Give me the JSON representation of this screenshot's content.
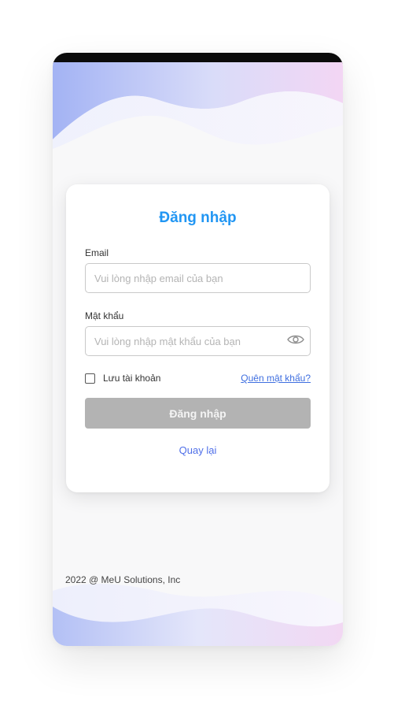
{
  "login": {
    "title": "Đăng nhập",
    "email_label": "Email",
    "email_placeholder": "Vui lòng nhập email của bạn",
    "email_value": "",
    "password_label": "Mật khẩu",
    "password_placeholder": "Vui lòng nhập mật khẩu của bạn",
    "password_value": "",
    "remember_label": "Lưu tài khoản",
    "remember_checked": false,
    "forgot_label": "Quên mật khẩu?",
    "submit_label": "Đăng nhập",
    "back_label": "Quay lại"
  },
  "footer": {
    "copyright": "2022 @ MeU Solutions, Inc"
  },
  "colors": {
    "title": "#2196f3",
    "link": "#3f6fe0",
    "button_disabled": "#b3b3b3",
    "wave_blue": "#a9b8f4",
    "wave_pink": "#f0d3f3"
  },
  "icons": {
    "password_toggle": "eye-icon"
  }
}
